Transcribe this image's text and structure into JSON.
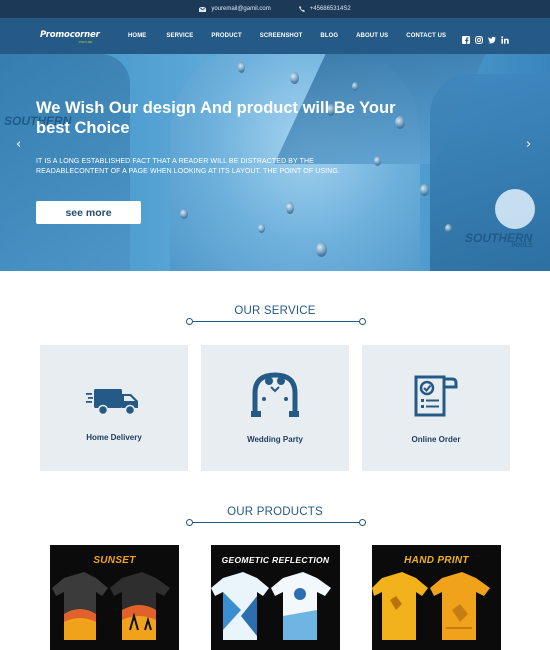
{
  "topbar": {
    "email": "youremail@gamil.com",
    "phone": "+456865314S2"
  },
  "nav": {
    "logo_main": "Promocorner",
    "logo_sub": ".com.au",
    "items": [
      {
        "label": "HOME"
      },
      {
        "label": "SERVICE"
      },
      {
        "label": "PRODUCT"
      },
      {
        "label": "SCREENSHOT"
      },
      {
        "label": "BLOG"
      },
      {
        "label": "ABOUT US"
      },
      {
        "label": "CONTACT US"
      }
    ],
    "social": [
      "facebook-icon",
      "instagram-icon",
      "twitter-icon",
      "linkedin-icon"
    ]
  },
  "hero": {
    "title": "We Wish Our design And product will Be Your best Choice",
    "text": "IT IS A LONG ESTABLISHED FACT THAT A READER WILL BE DISTRACTED BY THE READABLECONTENT OF A PAGE WHEN LOOKING AT ITS LAYOUT. THE POINT OF USING.",
    "button": "see more",
    "brand_left": "SOUTHERN",
    "brand_right": "SOUTHERN",
    "brand_right_sub": "POOLS",
    "prev": "‹",
    "next": "›"
  },
  "services": {
    "title": "OUR SERVICE",
    "items": [
      {
        "label": "Home Delivery",
        "icon": "delivery-truck-icon"
      },
      {
        "label": "Wedding Party",
        "icon": "wedding-arch-icon"
      },
      {
        "label": "Online Order",
        "icon": "order-document-icon"
      }
    ]
  },
  "products": {
    "title": "OUR PRODUCTS",
    "items": [
      {
        "title": "SUNSET",
        "color": "#f0a21a"
      },
      {
        "title": "GEOMETIC REFLECTION",
        "color": "#ffffff"
      },
      {
        "title": "HAND PRINT",
        "color": "#f2b21b"
      }
    ]
  },
  "colors": {
    "topbar": "#1c3a57",
    "nav": "#255a86",
    "accent": "#255a86",
    "card_bg": "#e8edf1"
  }
}
